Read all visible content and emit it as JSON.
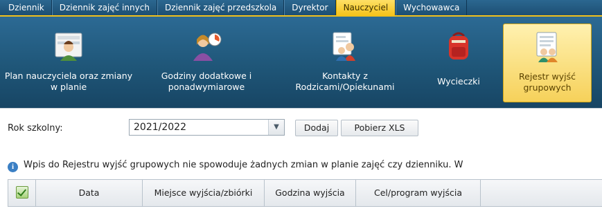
{
  "tabs": [
    {
      "label": "Dziennik",
      "active": false
    },
    {
      "label": "Dziennik zajęć innych",
      "active": false
    },
    {
      "label": "Dziennik zajęć przedszkola",
      "active": false
    },
    {
      "label": "Dyrektor",
      "active": false
    },
    {
      "label": "Nauczyciel",
      "active": true
    },
    {
      "label": "Wychowawca",
      "active": false
    }
  ],
  "ribbon": [
    {
      "label": "Plan nauczyciela oraz zmiany w planie",
      "icon": "teacher-plan-icon"
    },
    {
      "label": "Godziny dodatkowe i ponadwymiarowe",
      "icon": "extra-hours-icon"
    },
    {
      "label": "Kontakty z Rodzicami/Opiekunami",
      "icon": "parent-contacts-icon"
    },
    {
      "label": "Wycieczki",
      "icon": "backpack-icon"
    },
    {
      "label": "Rejestr wyjść grupowych",
      "icon": "group-outings-register-icon",
      "selected": true
    }
  ],
  "filter": {
    "year_label": "Rok szkolny:",
    "year_value": "2021/2022",
    "add_label": "Dodaj",
    "xls_label": "Pobierz XLS"
  },
  "info": {
    "text": "Wpis do Rejestru wyjść grupowych nie spowoduje żadnych zmian w planie zajęć czy dzienniku. W"
  },
  "table": {
    "columns": [
      "Data",
      "Miejsce wyjścia/zbiórki",
      "Godzina wyjścia",
      "Cel/program wyjścia"
    ]
  },
  "colors": {
    "tab_bar": "#1d4f73",
    "active_tab": "#f5c31c",
    "ribbon": "#1f5678",
    "selected_ribbon": "#f6d15a",
    "info_icon": "#3b7fc4"
  }
}
